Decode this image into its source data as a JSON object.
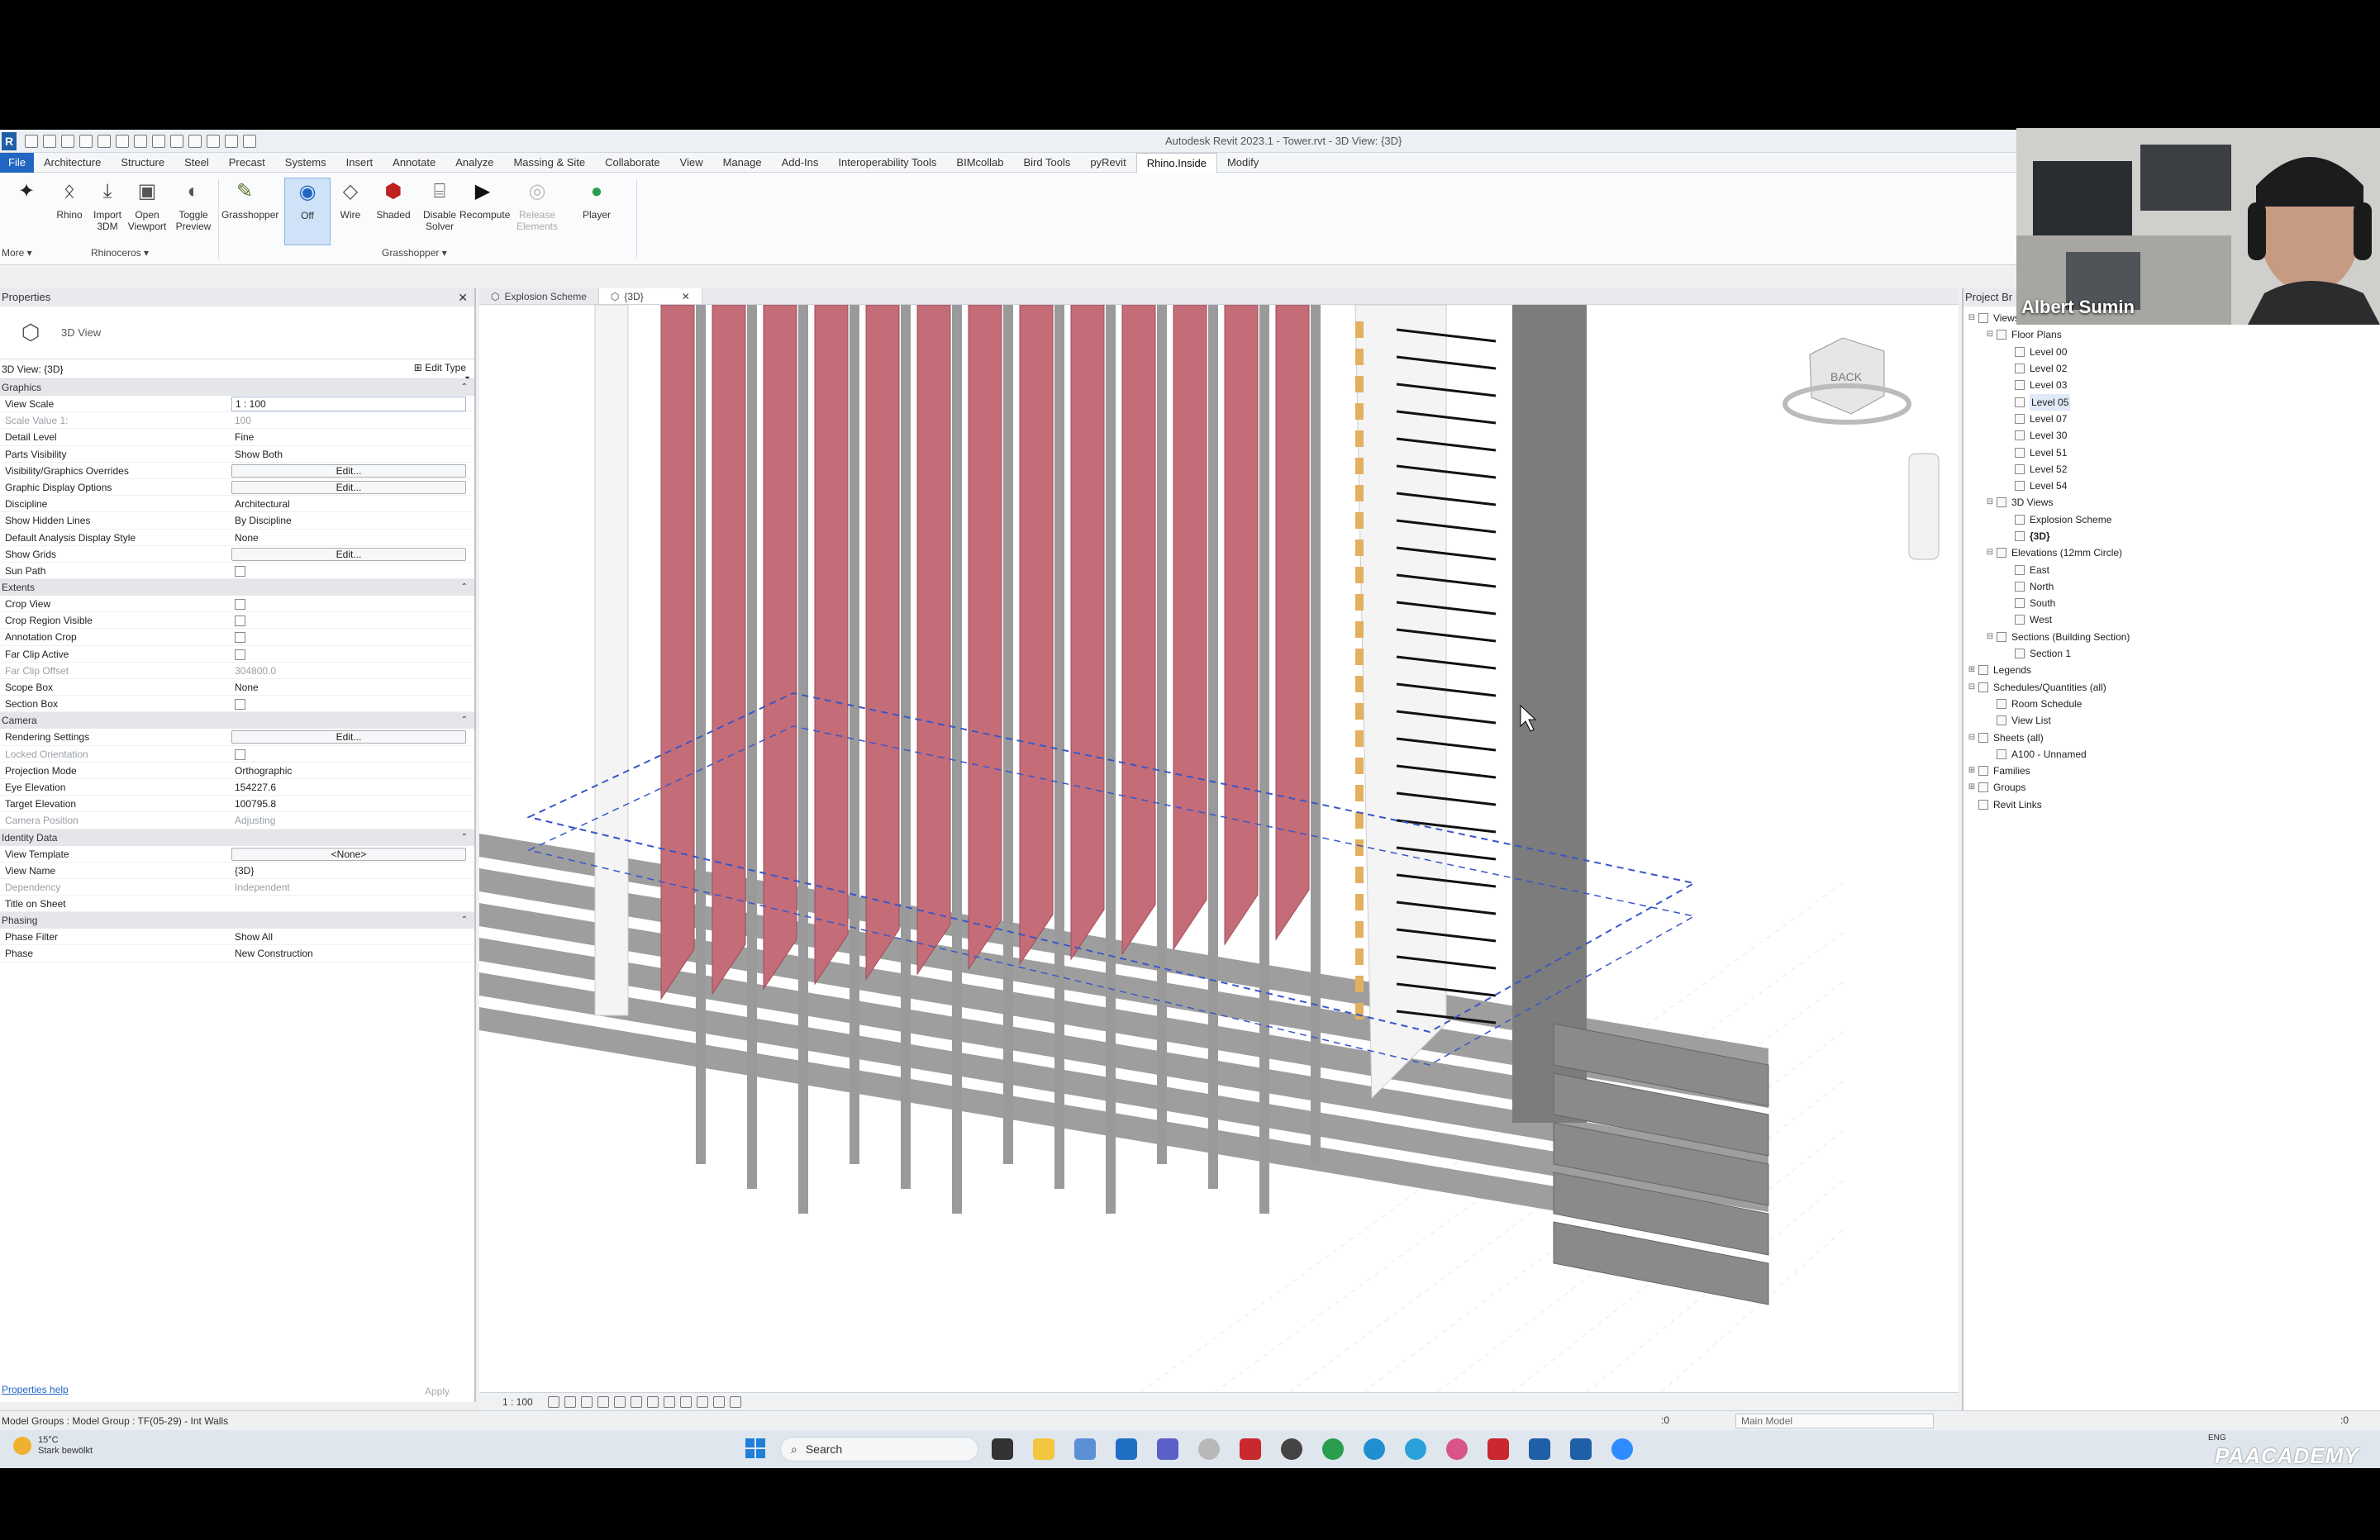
{
  "window_title": "Autodesk Revit 2023.1 - Tower.rvt - 3D View: {3D}",
  "ribbon": {
    "tabs": [
      "File",
      "Architecture",
      "Structure",
      "Steel",
      "Precast",
      "Systems",
      "Insert",
      "Annotate",
      "Analyze",
      "Massing & Site",
      "Collaborate",
      "View",
      "Manage",
      "Add-Ins",
      "Interoperability Tools",
      "BIMcollab",
      "Bird Tools",
      "pyRevit",
      "Rhino.Inside",
      "Modify"
    ],
    "active_tab": "Rhino.Inside",
    "buttons": [
      {
        "label": "",
        "icon": "rhino-logo-icon"
      },
      {
        "label": "Rhino",
        "icon": "rhino-icon"
      },
      {
        "label": "Import 3DM",
        "icon": "import-3dm-icon"
      },
      {
        "label": "Open Viewport",
        "icon": "viewport-icon"
      },
      {
        "label": "Toggle Preview",
        "icon": "preview-icon"
      },
      {
        "label": "Grasshopper",
        "icon": "grasshopper-icon"
      },
      {
        "label": "Off",
        "icon": "preview-off-icon",
        "selected": true
      },
      {
        "label": "Wire",
        "icon": "wire-icon"
      },
      {
        "label": "Shaded",
        "icon": "shaded-icon"
      },
      {
        "label": "Disable Solver",
        "icon": "solver-icon"
      },
      {
        "label": "Recompute",
        "icon": "recompute-icon"
      },
      {
        "label": "Release Elements",
        "icon": "release-icon",
        "disabled": true
      },
      {
        "label": "Player",
        "icon": "player-icon"
      }
    ],
    "more_label": "More ▾",
    "panel_rhinoceros": "Rhinoceros ▾",
    "panel_grasshopper": "Grasshopper ▾"
  },
  "properties": {
    "title": "Properties",
    "type_name": "3D View",
    "instance": "3D View: {3D}",
    "edit_type": "Edit Type",
    "sections": [
      {
        "name": "Graphics",
        "rows": [
          {
            "k": "View Scale",
            "v": "1 : 100",
            "kind": "input"
          },
          {
            "k": "Scale Value    1:",
            "v": "100",
            "dim": true
          },
          {
            "k": "Detail Level",
            "v": "Fine"
          },
          {
            "k": "Parts Visibility",
            "v": "Show Both"
          },
          {
            "k": "Visibility/Graphics Overrides",
            "v": "Edit...",
            "kind": "button"
          },
          {
            "k": "Graphic Display Options",
            "v": "Edit...",
            "kind": "button"
          },
          {
            "k": "Discipline",
            "v": "Architectural"
          },
          {
            "k": "Show Hidden Lines",
            "v": "By Discipline"
          },
          {
            "k": "Default Analysis Display Style",
            "v": "None"
          },
          {
            "k": "Show Grids",
            "v": "Edit...",
            "kind": "button"
          },
          {
            "k": "Sun Path",
            "v": "",
            "kind": "checkbox"
          }
        ]
      },
      {
        "name": "Extents",
        "rows": [
          {
            "k": "Crop View",
            "v": "",
            "kind": "checkbox"
          },
          {
            "k": "Crop Region Visible",
            "v": "",
            "kind": "checkbox"
          },
          {
            "k": "Annotation Crop",
            "v": "",
            "kind": "checkbox"
          },
          {
            "k": "Far Clip Active",
            "v": "",
            "kind": "checkbox"
          },
          {
            "k": "Far Clip Offset",
            "v": "304800.0",
            "dim": true
          },
          {
            "k": "Scope Box",
            "v": "None"
          },
          {
            "k": "Section Box",
            "v": "",
            "kind": "checkbox"
          }
        ]
      },
      {
        "name": "Camera",
        "rows": [
          {
            "k": "Rendering Settings",
            "v": "Edit...",
            "kind": "button"
          },
          {
            "k": "Locked Orientation",
            "v": "",
            "kind": "checkbox",
            "dim": true
          },
          {
            "k": "Projection Mode",
            "v": "Orthographic"
          },
          {
            "k": "Eye Elevation",
            "v": "154227.6"
          },
          {
            "k": "Target Elevation",
            "v": "100795.8"
          },
          {
            "k": "Camera Position",
            "v": "Adjusting",
            "dim": true
          }
        ]
      },
      {
        "name": "Identity Data",
        "rows": [
          {
            "k": "View Template",
            "v": "<None>",
            "kind": "button"
          },
          {
            "k": "View Name",
            "v": "{3D}"
          },
          {
            "k": "Dependency",
            "v": "Independent",
            "dim": true
          },
          {
            "k": "Title on Sheet",
            "v": ""
          }
        ]
      },
      {
        "name": "Phasing",
        "rows": [
          {
            "k": "Phase Filter",
            "v": "Show All"
          },
          {
            "k": "Phase",
            "v": "New Construction"
          }
        ]
      }
    ],
    "help": "Properties help",
    "apply": "Apply"
  },
  "view_tabs": [
    {
      "label": "Explosion Scheme",
      "active": false
    },
    {
      "label": "{3D}",
      "active": true
    }
  ],
  "view_bar": {
    "scale": "1 : 100"
  },
  "viewcube_label": "BACK",
  "browser": {
    "title": "Project Br",
    "nodes": [
      {
        "t": "Views",
        "lvl": 0,
        "tgl": "⊟"
      },
      {
        "t": "Floor Plans",
        "lvl": 1,
        "tgl": "⊟"
      },
      {
        "t": "Level 00",
        "lvl": 2
      },
      {
        "t": "Level 02",
        "lvl": 2
      },
      {
        "t": "Level 03",
        "lvl": 2
      },
      {
        "t": "Level 05",
        "lvl": 2,
        "hl": true
      },
      {
        "t": "Level 07",
        "lvl": 2
      },
      {
        "t": "Level 30",
        "lvl": 2
      },
      {
        "t": "Level 51",
        "lvl": 2
      },
      {
        "t": "Level 52",
        "lvl": 2
      },
      {
        "t": "Level 54",
        "lvl": 2
      },
      {
        "t": "3D Views",
        "lvl": 1,
        "tgl": "⊟"
      },
      {
        "t": "Explosion Scheme",
        "lvl": 2
      },
      {
        "t": "{3D}",
        "lvl": 2,
        "bold": true
      },
      {
        "t": "Elevations (12mm Circle)",
        "lvl": 1,
        "tgl": "⊟"
      },
      {
        "t": "East",
        "lvl": 2
      },
      {
        "t": "North",
        "lvl": 2
      },
      {
        "t": "South",
        "lvl": 2
      },
      {
        "t": "West",
        "lvl": 2
      },
      {
        "t": "Sections (Building Section)",
        "lvl": 1,
        "tgl": "⊟"
      },
      {
        "t": "Section 1",
        "lvl": 2
      },
      {
        "t": "Legends",
        "lvl": 0,
        "tgl": "⊞"
      },
      {
        "t": "Schedules/Quantities (all)",
        "lvl": 0,
        "tgl": "⊟"
      },
      {
        "t": "Room Schedule",
        "lvl": 1
      },
      {
        "t": "View List",
        "lvl": 1
      },
      {
        "t": "Sheets (all)",
        "lvl": 0,
        "tgl": "⊟"
      },
      {
        "t": "A100 - Unnamed",
        "lvl": 1
      },
      {
        "t": "Families",
        "lvl": 0,
        "tgl": "⊞"
      },
      {
        "t": "Groups",
        "lvl": 0,
        "tgl": "⊞"
      },
      {
        "t": "Revit Links",
        "lvl": 0
      }
    ]
  },
  "status": {
    "text": "Model Groups : Model Group : TF(05-29) - Int Walls",
    "zero": ":0",
    "model": "Main Model",
    "filter": ":0"
  },
  "taskbar": {
    "temp": "15°C",
    "weather": "Stark bewölkt",
    "search": "Search",
    "lang": "ENG",
    "brand": "PAACADEMY"
  },
  "webcam": {
    "name": "Albert Sumin"
  },
  "colors": {
    "accent": "#2266c3",
    "panel_red": "#c46d78",
    "slab_gray": "#8d8d8d",
    "wall_white": "#f4f4f4",
    "timber": "#e3b060"
  }
}
